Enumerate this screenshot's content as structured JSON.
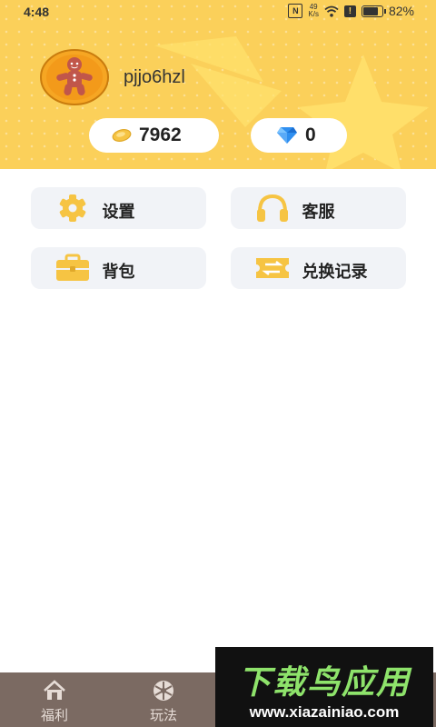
{
  "status_bar": {
    "time": "4:48",
    "nfc_label": "N",
    "network_speed_top": "49",
    "network_speed_bottom": "K/s",
    "alert_label": "!",
    "battery_percent": "82%",
    "battery_level": 0.82
  },
  "profile": {
    "username": "pjjo6hzl",
    "avatar_icon": "gingerbread-man-icon"
  },
  "balances": {
    "coins": "7962",
    "coin_icon": "coin-icon",
    "gems": "0",
    "gem_icon": "diamond-icon"
  },
  "menu": {
    "settings_label": "设置",
    "settings_icon": "gear-icon",
    "service_label": "客服",
    "service_icon": "headphones-icon",
    "bag_label": "背包",
    "bag_icon": "briefcase-icon",
    "exchange_label": "兑换记录",
    "exchange_icon": "exchange-ticket-icon"
  },
  "bottom_nav": {
    "welfare_label": "福利",
    "welfare_icon": "home-icon",
    "play_label": "玩法",
    "play_icon": "wheel-icon"
  },
  "watermark": {
    "title": "下载鸟应用",
    "url": "www.xiazainiao.com"
  },
  "colors": {
    "header_bg": "#fbd05a",
    "accent_yellow": "#f6c443",
    "button_bg": "#f1f3f7",
    "nav_bg": "#7b6a62",
    "watermark_green": "#8ee36b"
  }
}
